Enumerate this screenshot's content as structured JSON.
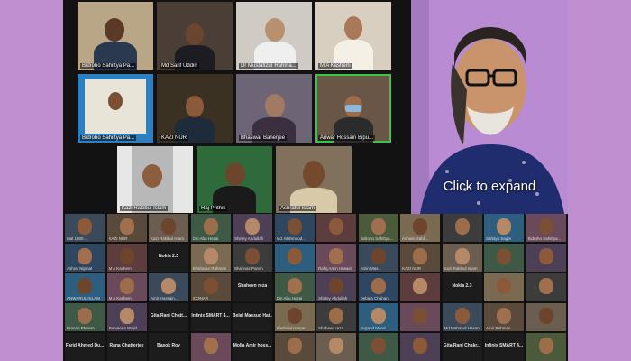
{
  "cta": "Click to expand",
  "top_tiles": [
    {
      "name": "Bidroho Sahittya Pa...",
      "bg": "#b9a686"
    },
    {
      "name": "Md Sarif Uddin",
      "bg": "#4a3e36"
    },
    {
      "name": "Dr Mustafizur Rahma...",
      "bg": "#cfcac4"
    },
    {
      "name": "M A Kashem",
      "bg": "#d8cfc0"
    },
    {
      "name": "Bidroho Sahittya Pa...",
      "bg": "#2d7fc0"
    },
    {
      "name": "KAZI NUR",
      "bg": "#3a3122"
    },
    {
      "name": "Bhaswar Banerjee",
      "bg": "#6d6576"
    },
    {
      "name": "Anwar Hossain Bipu...",
      "bg": "#6a5646"
    },
    {
      "name": "Kazi Rakibul Islam",
      "bg": "#e6e6e6"
    },
    {
      "name": "Raj Prithik",
      "bg": "#2e6a3a"
    },
    {
      "name": "Ashraful Islam",
      "bg": "#80705c"
    }
  ],
  "grid": [
    [
      "mal 1000 ...",
      "KAZI NUR",
      "Kazi Rakibul Islam",
      "Dm Abu Hozai",
      "Shirley Abdullah",
      "Md. Mahmood...",
      "",
      "Bidroho Sahittya...",
      "Ashwin Sabh...",
      "",
      "Sahityo Sagar",
      "Bidroho Sahittya..."
    ],
    [
      "Ashraf Nipinal",
      "M A Kashem",
      "Nokia 2.3",
      "Shahadur Rahman",
      "Shahnaz Parvin",
      "",
      "Rafiq Amin Husain",
      "Amin Mas...",
      "KAZI NUR",
      "Kazi Rakibul Islam",
      "",
      ""
    ],
    [
      "ANWARUL ISLAM",
      "M A Kashem",
      "Amir Hossain...",
      "ICONAR",
      "Shaheen reza",
      "Dm Abu Hozai",
      "Shirley Abdullah",
      "Debaja Chahan",
      "",
      "Nokia 2.3",
      "",
      ""
    ],
    [
      "Pronab Bhowm",
      "Parveena Wajid",
      "Gita Rani Chatt...",
      "Infinix SMART 4...",
      "Belal Massud Hai...",
      "Shahidul Haque",
      "Shaheen reza",
      "Sugand Morol",
      "",
      "Md Mahmud Hasan",
      "Amir Rahman",
      ""
    ],
    [
      "Farid Ahmed Du...",
      "Rana Chatterjee",
      "Basok Roy",
      "",
      "Molla Amir hoss...",
      "",
      "",
      "",
      "",
      "Gita Rani Chakr...",
      "Infinix SMART 4...",
      ""
    ]
  ],
  "grid_text_only": {
    "1-2": "Nokia 2.3",
    "2-4": "Shaheen reza",
    "2-9": "Nokia 2.3",
    "3-2": "Gita Rani Chatt...",
    "3-3": "Infinix SMART 4...",
    "3-4": "Belal Massud Hai...",
    "4-0": "Farid Ahmed Du...",
    "4-1": "Rana Chatterjee",
    "4-2": "Basok Roy",
    "4-4": "Molla Amir hoss...",
    "4-9": "Gita Rani Chakr...",
    "4-10": "Infinix SMART 4..."
  }
}
